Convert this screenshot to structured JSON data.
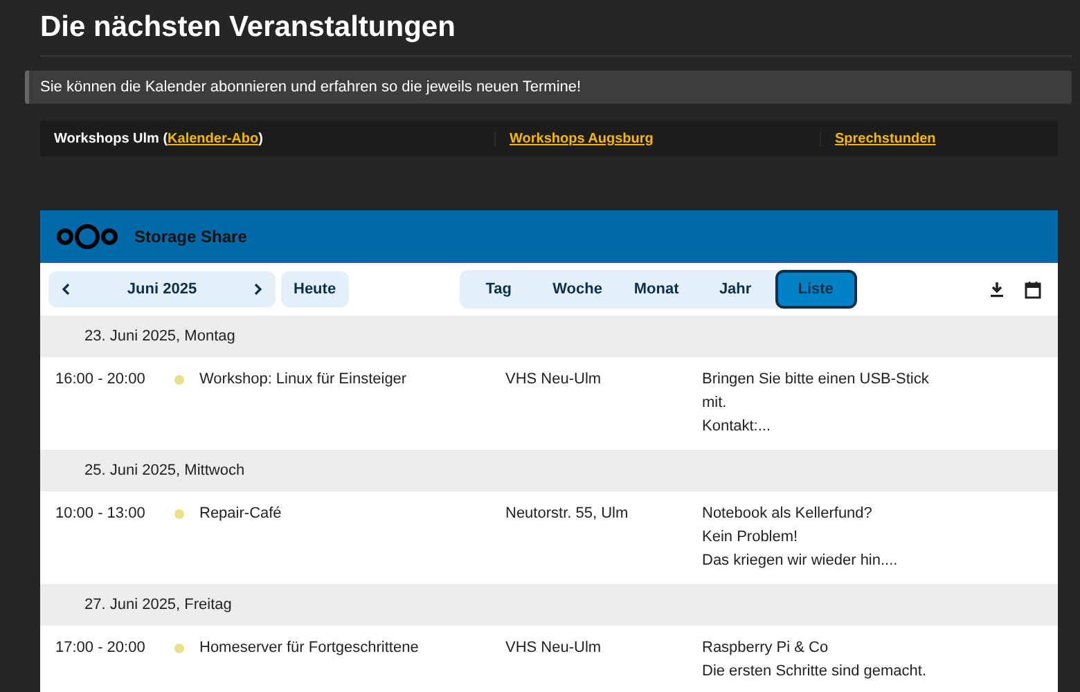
{
  "page_title": "Die nächsten Veranstaltungen",
  "notice": "Sie können die Kalender abonnieren und erfahren so die jeweils neuen Termine!",
  "calendar_links": [
    {
      "prefix": "Workshops Ulm (",
      "link": "Kalender-Abo",
      "suffix": ")"
    },
    {
      "link": "Workshops Augsburg"
    },
    {
      "link": "Sprechstunden"
    }
  ],
  "calendar": {
    "brand": "Storage Share",
    "month": "Juni 2025",
    "today_button": "Heute",
    "views": [
      {
        "label": "Tag",
        "selected": false
      },
      {
        "label": "Woche",
        "selected": false
      },
      {
        "label": "Monat",
        "selected": false
      },
      {
        "label": "Jahr",
        "selected": false
      },
      {
        "label": "Liste",
        "selected": true
      }
    ],
    "days": [
      {
        "heading": "23. Juni 2025, Montag",
        "events": [
          {
            "time": "16:00 - 20:00",
            "color": "#ebe08a",
            "title": "Workshop: Linux für Einsteiger",
            "location": "VHS Neu-Ulm",
            "description": [
              "Bringen Sie bitte einen USB-Stick mit.",
              "Kontakt:..."
            ]
          }
        ]
      },
      {
        "heading": "25. Juni 2025, Mittwoch",
        "events": [
          {
            "time": "10:00 - 13:00",
            "color": "#ebe08a",
            "title": "Repair-Café",
            "location": "Neutorstr. 55, Ulm",
            "description": [
              "Notebook als Kellerfund?",
              "Kein Problem!",
              "Das kriegen wir wieder hin...."
            ]
          }
        ]
      },
      {
        "heading": "27. Juni 2025, Freitag",
        "events": [
          {
            "time": "17:00 - 20:00",
            "color": "#ebe08a",
            "title": "Homeserver für Fortgeschrittene",
            "location": "VHS Neu-Ulm",
            "description": [
              "Raspberry Pi & Co",
              "Die ersten Schritte sind gemacht."
            ]
          }
        ]
      }
    ]
  }
}
